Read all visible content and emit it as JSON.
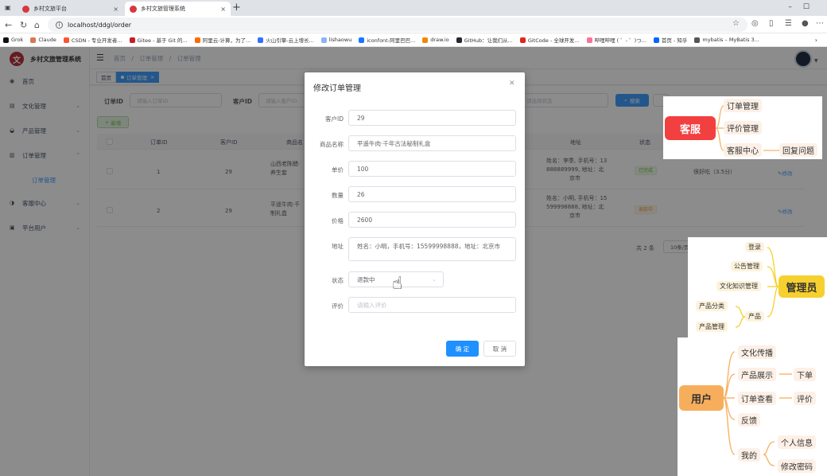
{
  "browser": {
    "tabs": [
      {
        "title": "乡村文旅平台",
        "close": "×"
      },
      {
        "title": "乡村文旅管理系统",
        "close": "×"
      }
    ],
    "new_tab": "+",
    "url": "localhost/ddgl/order",
    "bookmarks": [
      "Grok",
      "Claude",
      "CSDN - 专业开发者...",
      "Gitee - 基于 Git 的...",
      "阿里云-计算，为了...",
      "火山引擎-云上增长...",
      "lishaowu",
      "iconfont-阿里巴巴...",
      "draw.io",
      "GitHub：让我们从...",
      "GitCode - 全球开发...",
      "哔哩哔哩 ( ゜- ゜)つ...",
      "首页 - 知乎",
      "mybatis – MyBatis 3..."
    ]
  },
  "app": {
    "name": "乡村文旅管理系统",
    "menu": [
      {
        "label": "首页",
        "icon": "dashboard-icon"
      },
      {
        "label": "文化管理",
        "icon": "book-icon"
      },
      {
        "label": "产品管理",
        "icon": "box-icon"
      },
      {
        "label": "订单管理",
        "icon": "list-icon"
      },
      {
        "label": "客服中心",
        "icon": "service-icon"
      },
      {
        "label": "平台用户",
        "icon": "user-icon"
      }
    ],
    "submenu_active": "订单管理",
    "breadcrumb": [
      "首页",
      "订单管理",
      "订单管理"
    ],
    "tags": {
      "home": "首页",
      "order": "订单管理"
    },
    "search": {
      "order_id_label": "订单ID",
      "order_id_placeholder": "请输入订单ID",
      "customer_id_label": "客户ID",
      "customer_id_placeholder": "请输入客户ID",
      "status_placeholder": "请选择状态",
      "search_button": "搜索"
    },
    "add_button": "新增",
    "table": {
      "headers": [
        "订单ID",
        "客户ID",
        "商品名",
        "地址",
        "状态"
      ],
      "rows": [
        {
          "order_id": "1",
          "customer_id": "29",
          "product": [
            "山西老陈醋·",
            "养生套"
          ],
          "address": [
            "姓名：李季, 手机号：13",
            "888889999, 地址：北",
            "京市"
          ],
          "status": "已完成",
          "rating": "很好吃（3.5分）",
          "edit": "修改"
        },
        {
          "order_id": "2",
          "customer_id": "29",
          "product": [
            "平遥牛肉·千",
            "制礼盒"
          ],
          "address": [
            "姓名：小明, 手机号：15",
            "599998888, 地址：北",
            "京市"
          ],
          "status": "退款中",
          "rating": "",
          "edit": "修改"
        }
      ]
    },
    "pagination": {
      "total": "共 2 条",
      "page_size": "10条/页"
    }
  },
  "dialog": {
    "title": "修改订单管理",
    "fields": [
      {
        "label": "客户ID",
        "value": "29"
      },
      {
        "label": "商品名称",
        "value": "平遥牛肉·千年古法秘制礼盒"
      },
      {
        "label": "单价",
        "value": "100"
      },
      {
        "label": "数量",
        "value": "26"
      },
      {
        "label": "价格",
        "value": "2600"
      },
      {
        "label": "地址",
        "value": "姓名：小明，手机号：15599998888，地址：北京市"
      },
      {
        "label": "状态",
        "value": "退款中"
      },
      {
        "label": "评价",
        "placeholder": "请输入评价"
      }
    ],
    "confirm": "确 定",
    "cancel": "取 消"
  },
  "mindmaps": {
    "service": {
      "root": "客服",
      "children": [
        "订单管理",
        "评价管理",
        "客服中心"
      ],
      "leaf": "回复问题"
    },
    "admin": {
      "root": "管理员",
      "children": [
        "登录",
        "公告管理",
        "文化知识管理",
        "产品"
      ],
      "product_children": [
        "产品分类",
        "产品管理"
      ]
    },
    "user": {
      "root": "用户",
      "children": [
        "文化传播",
        "产品展示",
        "订单查看",
        "反馈",
        "我的"
      ],
      "product_leaf": "下单",
      "order_leaf": "评价",
      "mine_children": [
        "个人信息",
        "修改密码"
      ]
    }
  },
  "colors": {
    "primary": "#409eff",
    "service_root": "#f23f3f",
    "admin_root": "#f6d02e",
    "user_root": "#f7ae5c"
  }
}
